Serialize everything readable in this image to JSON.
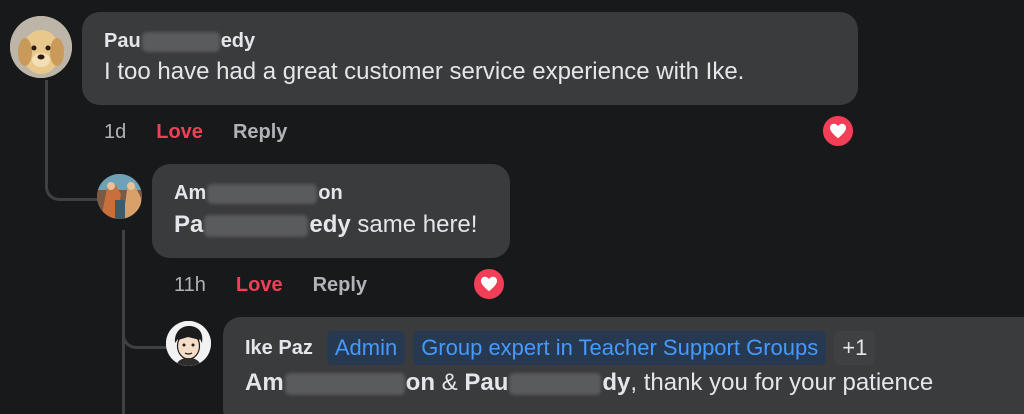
{
  "comments": [
    {
      "author_prefix": "Pau",
      "author_suffix": "edy",
      "text": "I too have had a great customer service experience with Ike.",
      "time": "1d",
      "love_label": "Love",
      "reply_label": "Reply",
      "avatar_icon": "golden-retriever-puppy-avatar",
      "reaction_icon": "heart-icon"
    },
    {
      "author_prefix": "Am",
      "author_suffix": "on",
      "mention_prefix": "Pa",
      "mention_suffix": "edy",
      "text": " same here!",
      "time": "11h",
      "love_label": "Love",
      "reply_label": "Reply",
      "avatar_icon": "painting-avatar",
      "reaction_icon": "heart-icon"
    },
    {
      "author": "Ike Paz",
      "badges": [
        "Admin",
        "Group expert in Teacher Support Groups",
        "+1"
      ],
      "mention1_prefix": "Am",
      "mention1_suffix": "on",
      "amp": " & ",
      "mention2_prefix": "Pau",
      "mention2_suffix": "dy",
      "text": ", thank you for your patience",
      "avatar_icon": "cartoon-man-avatar"
    }
  ],
  "colors": {
    "background": "#18191a",
    "bubble": "#3a3b3c",
    "love": "#f33e58",
    "badge_text": "#4599ff"
  }
}
